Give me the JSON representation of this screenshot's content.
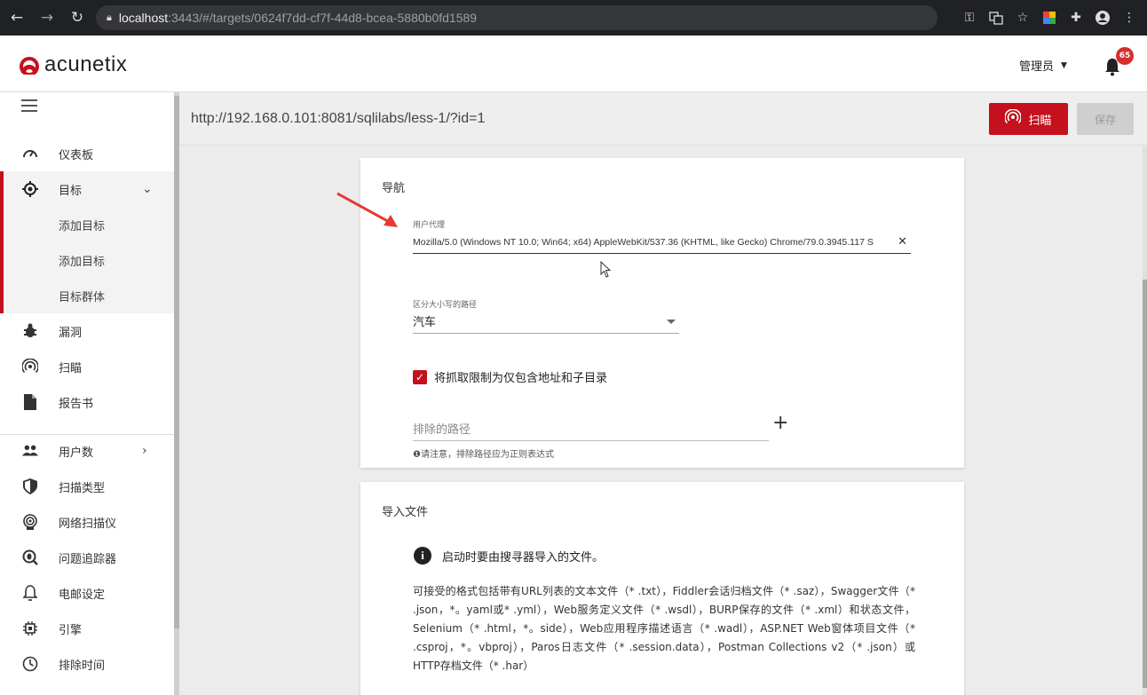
{
  "browser": {
    "url_host": "localhost",
    "url_path": ":3443/#/targets/0624f7dd-cf7f-44d8-bcea-5880b0fd1589"
  },
  "header": {
    "logo_text": "acunetix",
    "user_label": "管理员",
    "notification_count": "65",
    "brand_color": "#c4111d"
  },
  "sidebar": {
    "items": [
      {
        "label": "仪表板",
        "icon": "dashboard-icon"
      },
      {
        "label": "目标",
        "icon": "target-icon"
      },
      {
        "label": "添加目标",
        "icon": ""
      },
      {
        "label": "添加目标",
        "icon": ""
      },
      {
        "label": "目标群体",
        "icon": ""
      },
      {
        "label": "漏洞",
        "icon": "bug-icon"
      },
      {
        "label": "扫瞄",
        "icon": "scan-icon"
      },
      {
        "label": "报告书",
        "icon": "report-icon"
      },
      {
        "label": "用户数",
        "icon": "users-icon"
      },
      {
        "label": "扫描类型",
        "icon": "shield-icon"
      },
      {
        "label": "网络扫描仪",
        "icon": "network-scanner-icon"
      },
      {
        "label": "问题追踪器",
        "icon": "issue-tracker-icon"
      },
      {
        "label": "电邮设定",
        "icon": "bell-outline-icon"
      },
      {
        "label": "引擎",
        "icon": "engine-icon"
      },
      {
        "label": "排除时间",
        "icon": "clock-icon"
      }
    ]
  },
  "main": {
    "target_url": "http://192.168.0.101:8081/sqlilabs/less-1/?id=1",
    "scan_button": "扫瞄",
    "save_button": "保存",
    "nav_card": {
      "title": "导航",
      "user_agent_label": "用户代理",
      "user_agent_value": "Mozilla/5.0 (Windows NT 10.0; Win64; x64) AppleWebKit/537.36 (KHTML, like Gecko) Chrome/79.0.3945.117 S",
      "case_path_label": "区分大小写的路径",
      "case_path_value": "汽车",
      "restrict_checkbox_label": "将抓取限制为仅包含地址和子目录",
      "restrict_checked": true,
      "exclude_placeholder": "排除的路径",
      "exclude_hint": "❶请注意，排除路径应为正则表达式"
    },
    "import_card": {
      "title": "导入文件",
      "info_text": "启动时要由搜寻器导入的文件。",
      "formats_text": "可接受的格式包括带有URL列表的文本文件（* .txt），Fiddler会话归档文件（* .saz），Swagger文件（* .json，*。yaml或* .yml），Web服务定义文件（* .wsdl），BURP保存的文件（* .xml）和状态文件，Selenium（* .html，*。side），Web应用程序描述语言（* .wadl），ASP.NET Web窗体项目文件（* .csproj，*。vbproj），Paros日志文件（* .session.data），Postman Collections v2（* .json）或HTTP存档文件（* .har）"
    }
  }
}
